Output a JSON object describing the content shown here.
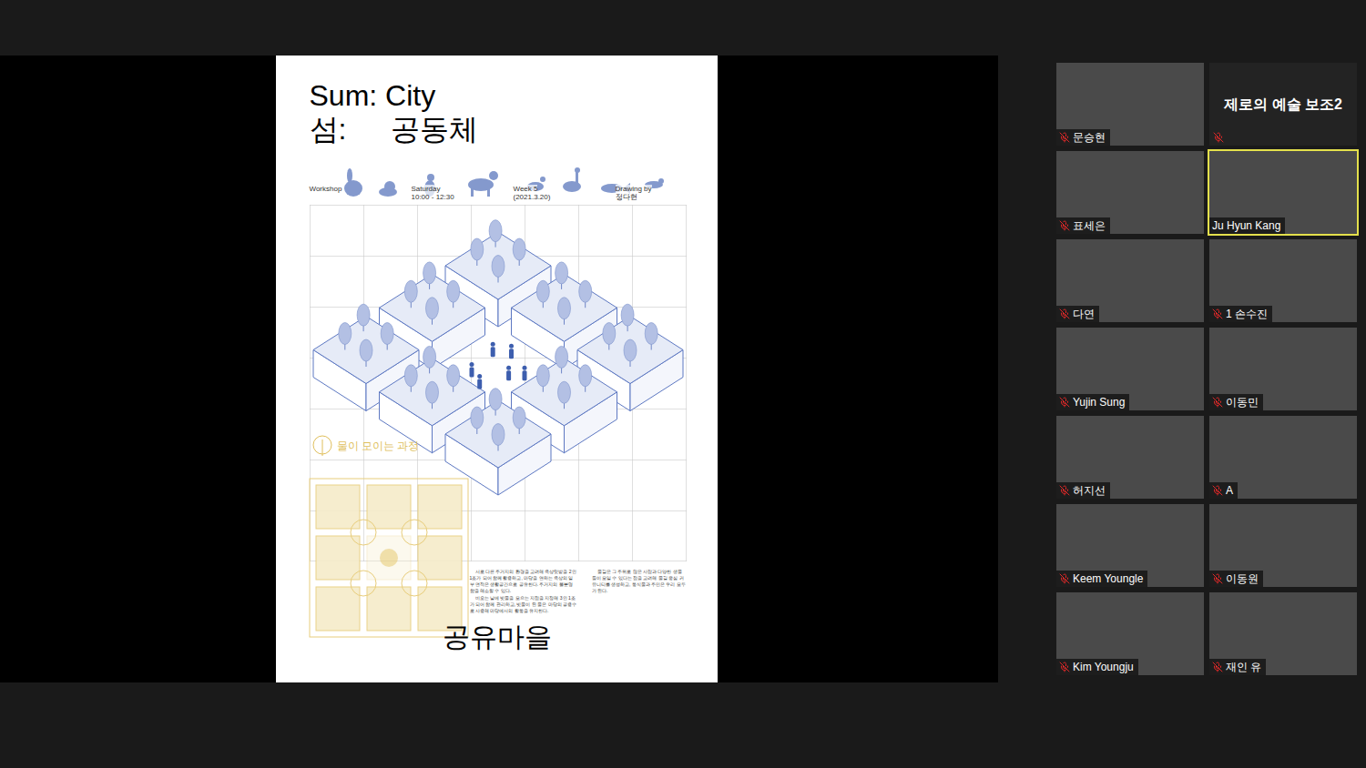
{
  "shared_screen": {
    "poster": {
      "title_en": "Sum: City",
      "title_ko_1": "섬:",
      "title_ko_2": "공동체",
      "header": [
        {
          "lines": [
            "Workshop"
          ]
        },
        {
          "lines": [
            "Saturday",
            "10:00 - 12:30"
          ]
        },
        {
          "lines": [
            "Week 5",
            "(2021.3.20)"
          ]
        },
        {
          "lines": [
            "Drawing by",
            "정다현"
          ]
        }
      ],
      "caption": "물이 모이는 과정",
      "paragraphs_left": [
        "서로 다른 주거지의 환경을 고려해 옥상텃밭을 2인1조가 되어 함께 활용하고, 마당을 연하는 옥상의 일부 면적은 생활공간으로 공유한다. 주거지의 불분명함을 해소할 수 있다.",
        "비오는 날에 빗물을 모으는 지점을 지정해 3인 1조가 되어 함께 관리하고, 빗물이 된 물은 마당의 공용수로 사용해 마당에서의 활동을 유지한다."
      ],
      "paragraphs_right": [
        "물길은 그 주위로 많은 사람과 다양한 생물들이 모일 수 있다는 점을 고려해 물길 중심 커뮤니티를 생성하고, 동식물과 주민은 우리 모두가 된다."
      ],
      "footer_title": "공유마을"
    }
  },
  "participants": [
    {
      "name": "문승현",
      "muted": true,
      "video": true,
      "speaking": false
    },
    {
      "name": "제로의 예술 보조2",
      "muted": true,
      "video": false,
      "speaking": false
    },
    {
      "name": "표세은",
      "muted": true,
      "video": true,
      "speaking": false
    },
    {
      "name": "Ju Hyun Kang",
      "muted": false,
      "video": true,
      "speaking": true
    },
    {
      "name": "다연",
      "muted": true,
      "video": true,
      "speaking": false
    },
    {
      "name": "1 손수진",
      "muted": true,
      "video": true,
      "speaking": false
    },
    {
      "name": "Yujin Sung",
      "muted": true,
      "video": true,
      "speaking": false
    },
    {
      "name": "이동민",
      "muted": true,
      "video": true,
      "speaking": false
    },
    {
      "name": "허지선",
      "muted": true,
      "video": true,
      "speaking": false
    },
    {
      "name": "A",
      "muted": true,
      "video": true,
      "speaking": false
    },
    {
      "name": "Keem Youngle",
      "muted": true,
      "video": true,
      "speaking": false
    },
    {
      "name": "이동원",
      "muted": true,
      "video": true,
      "speaking": false
    },
    {
      "name": "Kim Youngju",
      "muted": true,
      "video": true,
      "speaking": false
    },
    {
      "name": "재인 유",
      "muted": true,
      "video": true,
      "speaking": false
    }
  ]
}
